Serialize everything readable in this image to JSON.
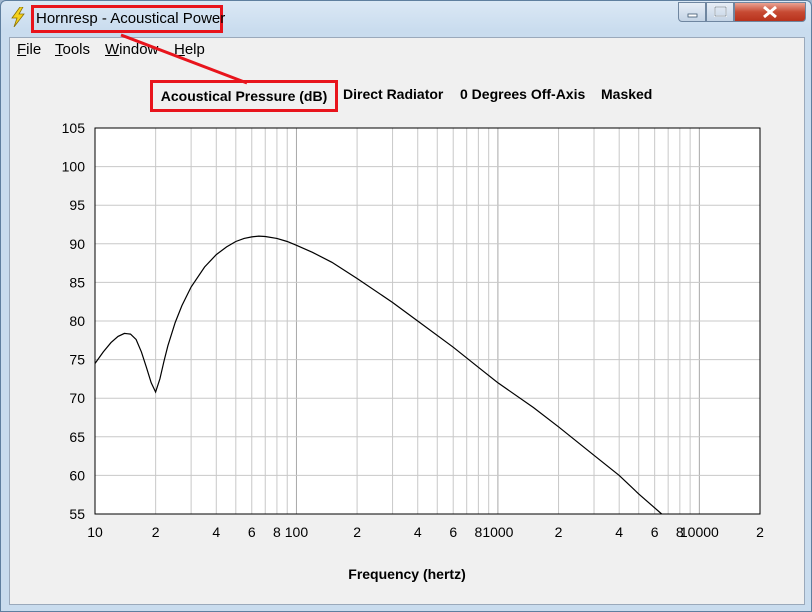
{
  "window": {
    "title": "Hornresp - Acoustical Power"
  },
  "menu": [
    "File",
    "Tools",
    "Window",
    "Help"
  ],
  "header": {
    "main": "Acoustical Pressure (dB)",
    "items": [
      "Direct Radiator",
      "0 Degrees Off-Axis",
      "Masked"
    ]
  },
  "colors": {
    "highlight": "#e8141c",
    "curve": "#000000",
    "grid": "#c8c8c8"
  },
  "chart_data": {
    "type": "line",
    "xscale": "log",
    "xlim": [
      10,
      20000
    ],
    "ylim": [
      55,
      105
    ],
    "xlabel": "Frequency (hertz)",
    "ylabel": "",
    "y_ticks": [
      55,
      60,
      65,
      70,
      75,
      80,
      85,
      90,
      95,
      100,
      105
    ],
    "x_tick_labels": [
      {
        "x": 10,
        "label": "10"
      },
      {
        "x": 20,
        "label": "2"
      },
      {
        "x": 40,
        "label": "4"
      },
      {
        "x": 60,
        "label": "6"
      },
      {
        "x": 80,
        "label": "8"
      },
      {
        "x": 100,
        "label": "100"
      },
      {
        "x": 200,
        "label": "2"
      },
      {
        "x": 400,
        "label": "4"
      },
      {
        "x": 600,
        "label": "6"
      },
      {
        "x": 800,
        "label": "8"
      },
      {
        "x": 1000,
        "label": "1000"
      },
      {
        "x": 2000,
        "label": "2"
      },
      {
        "x": 4000,
        "label": "4"
      },
      {
        "x": 6000,
        "label": "6"
      },
      {
        "x": 8000,
        "label": "8"
      },
      {
        "x": 10000,
        "label": "10000"
      },
      {
        "x": 20000,
        "label": "2"
      }
    ],
    "series": [
      {
        "points": [
          [
            10,
            74.5
          ],
          [
            11,
            76.0
          ],
          [
            12,
            77.2
          ],
          [
            13,
            78.0
          ],
          [
            14,
            78.4
          ],
          [
            15,
            78.3
          ],
          [
            16,
            77.6
          ],
          [
            17,
            76.0
          ],
          [
            18,
            74.0
          ],
          [
            19,
            72.0
          ],
          [
            20,
            70.8
          ],
          [
            21,
            72.5
          ],
          [
            22,
            74.8
          ],
          [
            23,
            76.8
          ],
          [
            25,
            79.8
          ],
          [
            27,
            82.0
          ],
          [
            30,
            84.4
          ],
          [
            35,
            87.0
          ],
          [
            40,
            88.6
          ],
          [
            45,
            89.6
          ],
          [
            50,
            90.3
          ],
          [
            55,
            90.7
          ],
          [
            60,
            90.9
          ],
          [
            65,
            91.0
          ],
          [
            70,
            90.95
          ],
          [
            80,
            90.7
          ],
          [
            90,
            90.3
          ],
          [
            100,
            89.8
          ],
          [
            120,
            88.9
          ],
          [
            150,
            87.6
          ],
          [
            200,
            85.5
          ],
          [
            300,
            82.4
          ],
          [
            400,
            80.0
          ],
          [
            600,
            76.6
          ],
          [
            800,
            74.0
          ],
          [
            1000,
            72.0
          ],
          [
            1500,
            68.8
          ],
          [
            2000,
            66.3
          ],
          [
            3000,
            62.6
          ],
          [
            4000,
            60.0
          ],
          [
            5000,
            57.6
          ],
          [
            6500,
            55.0
          ]
        ]
      }
    ]
  }
}
